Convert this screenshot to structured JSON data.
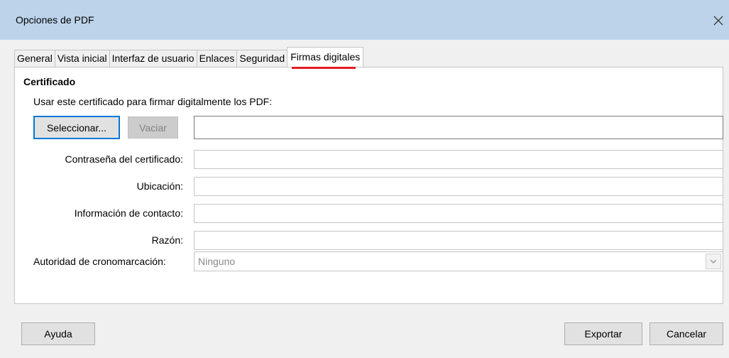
{
  "window": {
    "title": "Opciones de PDF"
  },
  "tabs": [
    {
      "label": "General"
    },
    {
      "label": "Vista inicial"
    },
    {
      "label": "Interfaz de usuario"
    },
    {
      "label": "Enlaces"
    },
    {
      "label": "Seguridad"
    },
    {
      "label": "Firmas digitales"
    }
  ],
  "active_tab": "Firmas digitales",
  "certificate": {
    "section_title": "Certificado",
    "description": "Usar este certificado para firmar digitalmente los PDF:",
    "select_button": "Seleccionar...",
    "clear_button": "Vaciar",
    "certificate_value": ""
  },
  "fields": {
    "password_label": "Contraseña del certificado:",
    "password_value": "",
    "location_label": "Ubicación:",
    "location_value": "",
    "contact_label": "Información de contacto:",
    "contact_value": "",
    "reason_label": "Razón:",
    "reason_value": "",
    "tsa_label": "Autoridad de cronomarcación:",
    "tsa_value": "Ninguno"
  },
  "buttons": {
    "help": "Ayuda",
    "export": "Exportar",
    "cancel": "Cancelar"
  },
  "colors": {
    "titlebar": "#bcd3ea",
    "active_tab_highlight": "#e21b24",
    "focus_border": "#0078d7"
  }
}
